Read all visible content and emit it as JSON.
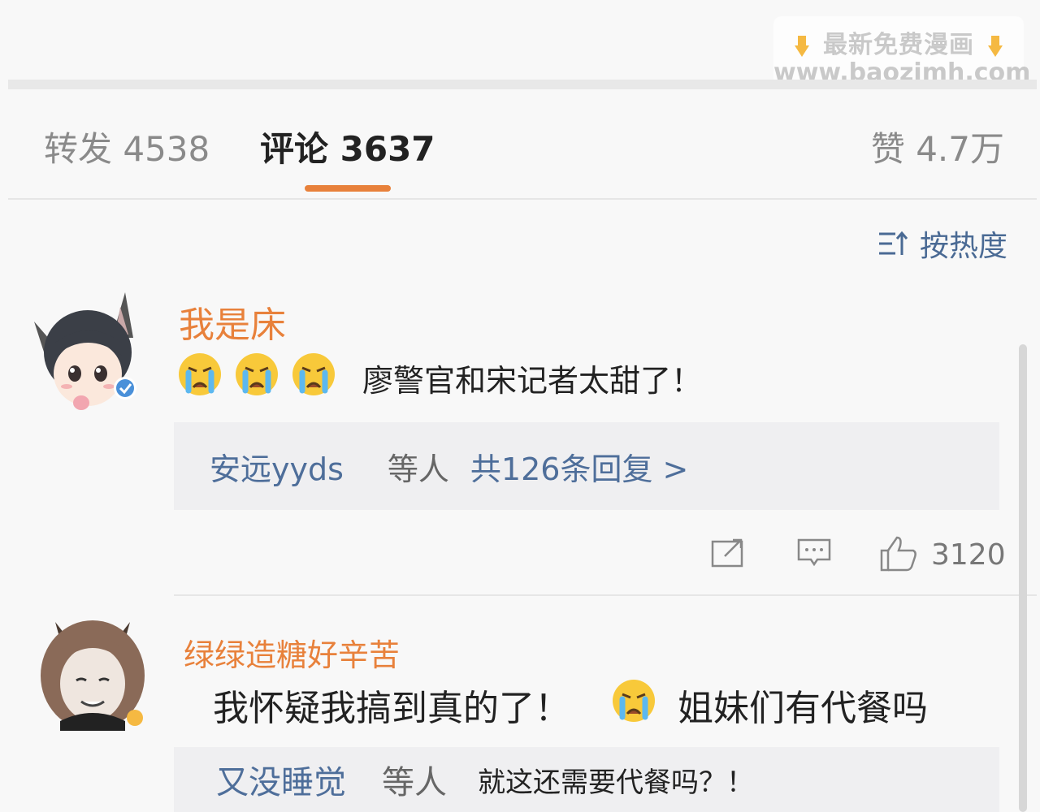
{
  "watermark": {
    "line1": "最新免费漫画",
    "line2": "www.baozimh.com"
  },
  "tabs": {
    "forward": "转发 4538",
    "comment": "评论 3637",
    "like": "赞 4.7万"
  },
  "sort": {
    "label": "按热度",
    "icon": "sort-icon"
  },
  "comments": [
    {
      "username": "我是床",
      "text": "廖警官和宋记者太甜了！",
      "emoji_icon": "crying-face-emoji",
      "reply": {
        "user": "安远yyds",
        "mid": "等人",
        "link": "共126条回复 >"
      },
      "actions": {
        "share_icon": "share-icon",
        "comment_icon": "comment-icon",
        "like_icon": "thumbs-up-icon",
        "like_count": "3120"
      }
    },
    {
      "username": "绿绿造糖好辛苦",
      "text_before": "我怀疑我搞到真的了！",
      "text_after": "姐妹们有代餐吗",
      "emoji_icon": "crying-face-emoji",
      "reply": {
        "user": "又没睡觉",
        "mid": "等人",
        "text": "就这还需要代餐吗？！"
      }
    }
  ],
  "colors": {
    "accent": "#e8813b",
    "link": "#4e6e9a"
  }
}
